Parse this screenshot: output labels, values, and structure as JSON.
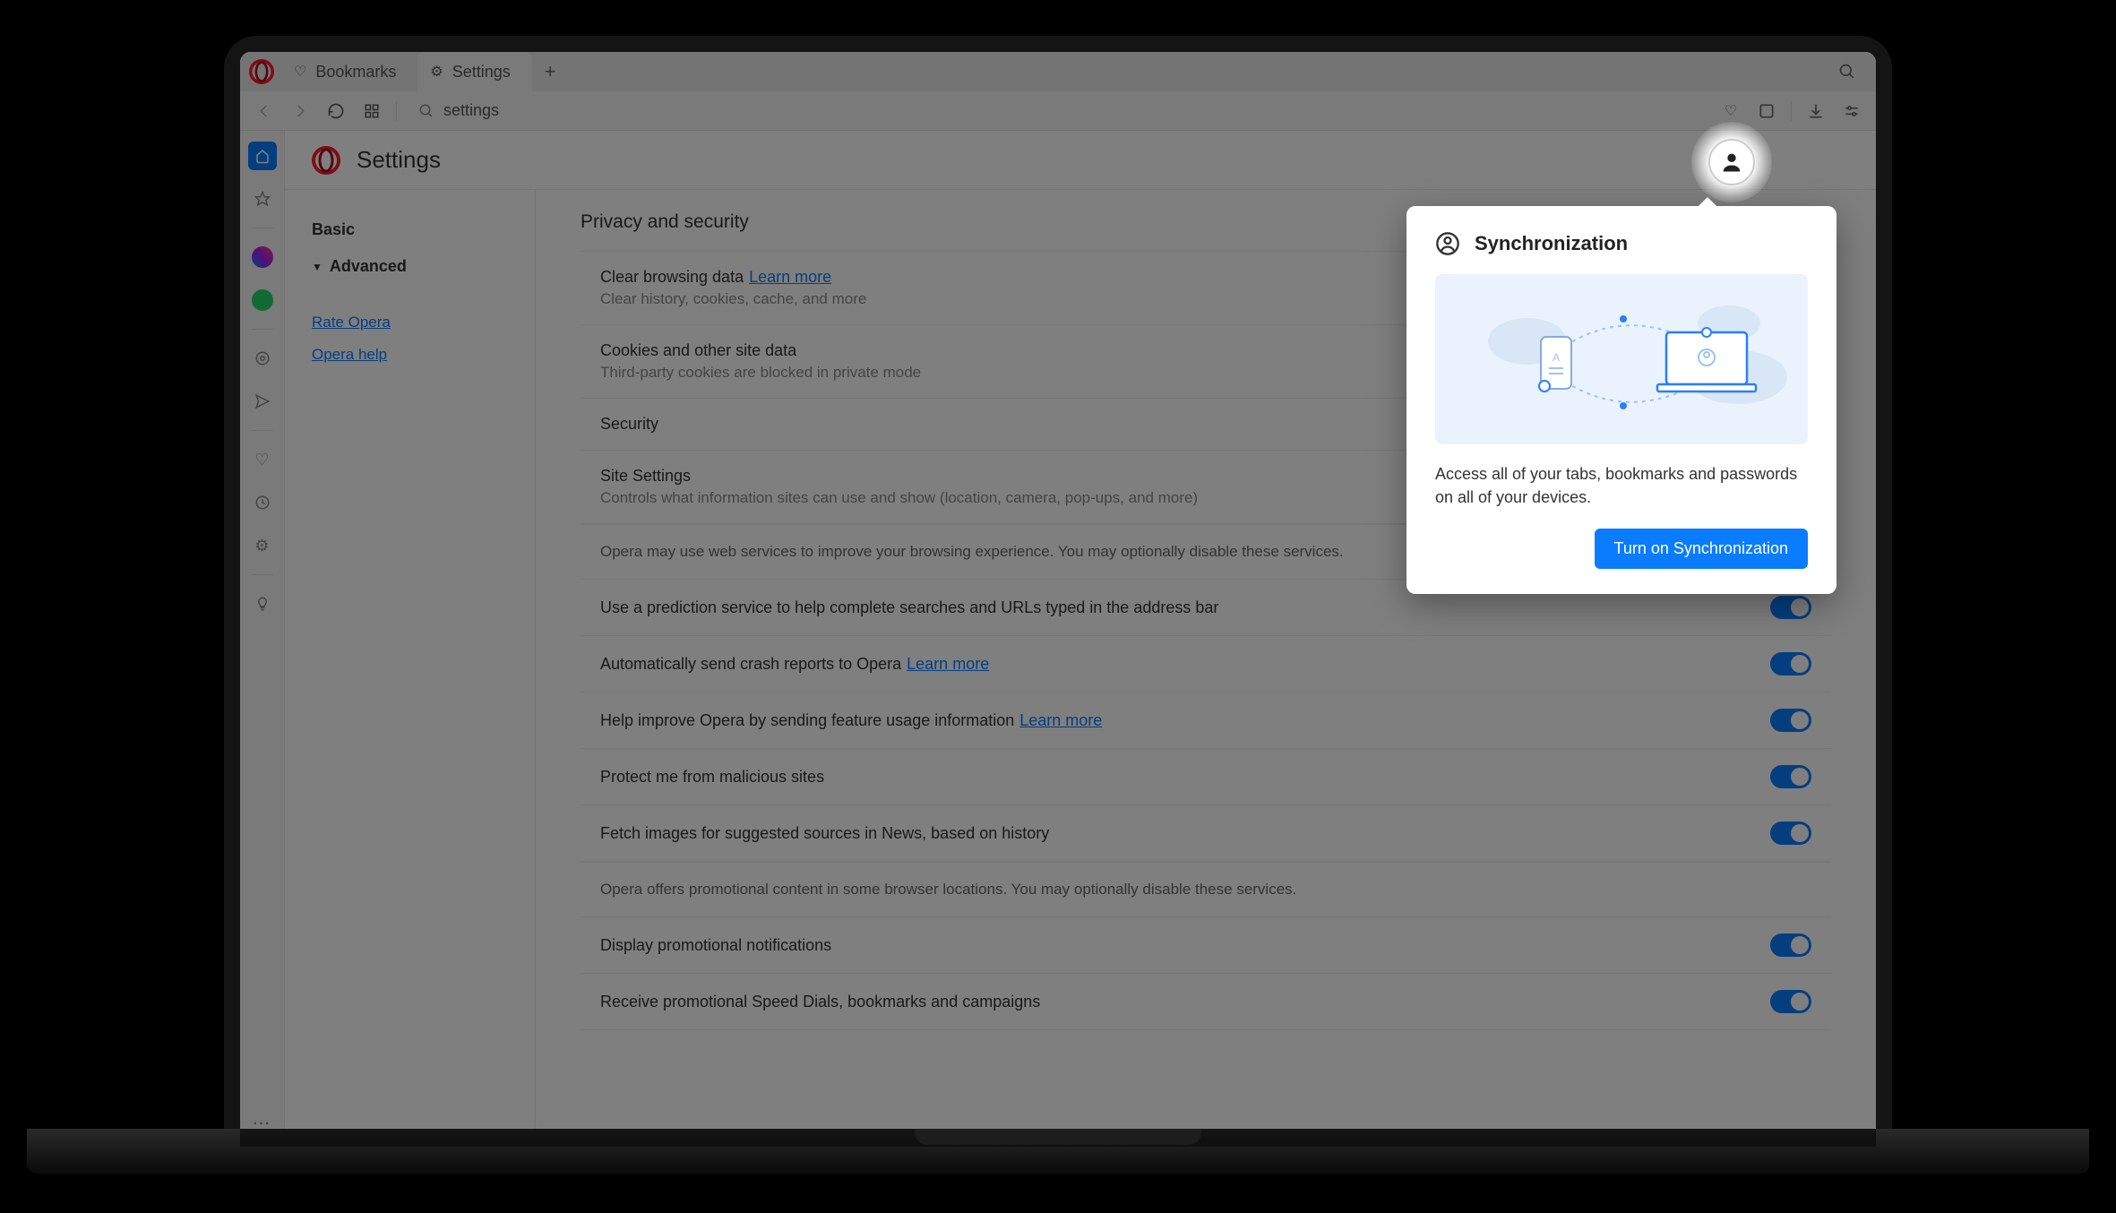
{
  "tabs": {
    "bookmarks_label": "Bookmarks",
    "settings_label": "Settings"
  },
  "address_bar": {
    "input_value": "settings"
  },
  "page_title": "Settings",
  "side_nav": {
    "basic": "Basic",
    "advanced": "Advanced",
    "rate": "Rate Opera",
    "help": "Opera help"
  },
  "section": {
    "title": "Privacy and security"
  },
  "learn_more": "Learn more",
  "rows": [
    {
      "title": "Clear browsing data",
      "sub": "Clear history, cookies, cache, and more",
      "learn_more": true,
      "arrow": true
    },
    {
      "title": "Cookies and other site data",
      "sub": "Third-party cookies are blocked in private mode",
      "arrow": true
    },
    {
      "title": "Security",
      "arrow": true
    },
    {
      "title": "Site Settings",
      "sub": "Controls what information sites can use and show (location, camera, pop-ups, and more)",
      "arrow": true
    }
  ],
  "info1": "Opera may use web services to improve your browsing experience. You may optionally disable these services.",
  "toggles": [
    {
      "title": "Use a prediction service to help complete searches and URLs typed in the address bar"
    },
    {
      "title": "Automatically send crash reports to Opera",
      "learn_more": true
    },
    {
      "title": "Help improve Opera by sending feature usage information",
      "learn_more": true
    },
    {
      "title": "Protect me from malicious sites"
    },
    {
      "title": "Fetch images for suggested sources in News, based on history"
    }
  ],
  "info2": "Opera offers promotional content in some browser locations. You may optionally disable these services.",
  "toggles2": [
    {
      "title": "Display promotional notifications"
    },
    {
      "title": "Receive promotional Speed Dials, bookmarks and campaigns"
    }
  ],
  "popover": {
    "title": "Synchronization",
    "desc": "Access all of your tabs, bookmarks and passwords on all of your devices.",
    "button": "Turn on Synchronization"
  }
}
